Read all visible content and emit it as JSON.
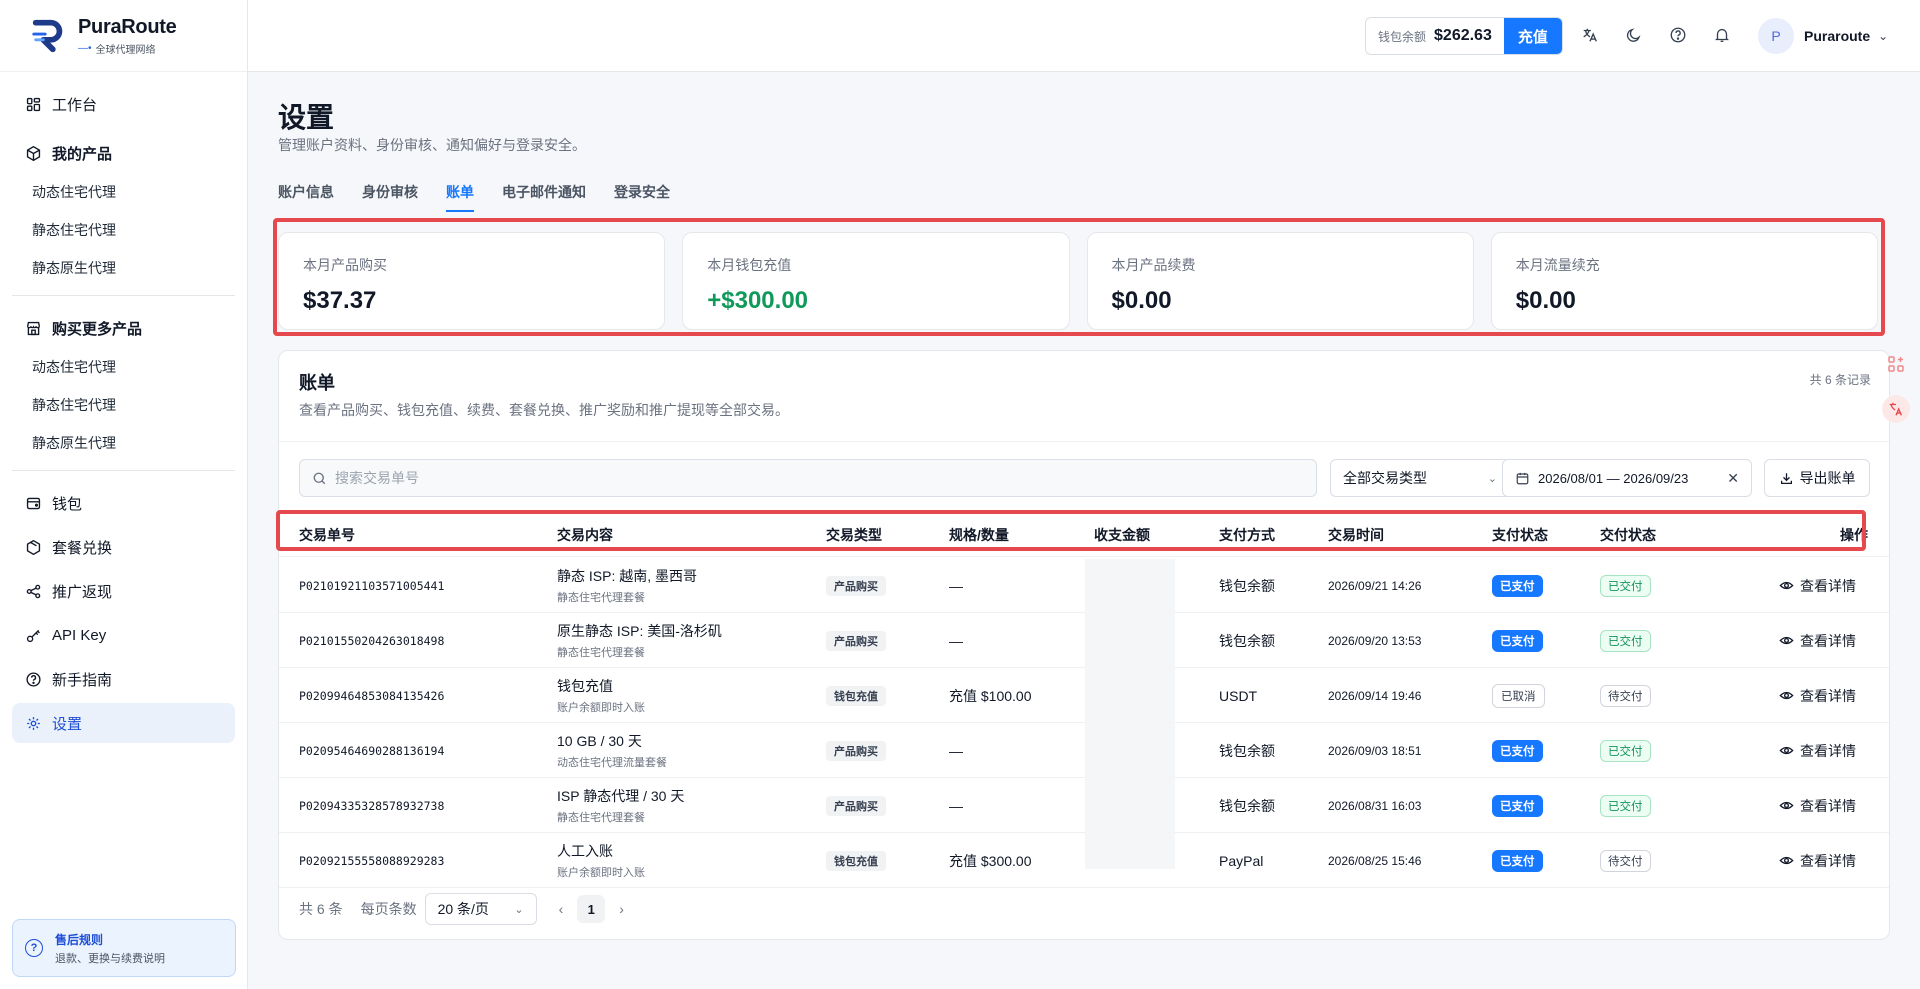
{
  "brand": {
    "name": "PuraRoute",
    "tagline": "全球代理网络"
  },
  "sidebar": {
    "workbench": "工作台",
    "my_products": {
      "label": "我的产品",
      "items": [
        "动态住宅代理",
        "静态住宅代理",
        "静态原生代理"
      ]
    },
    "buy_more": {
      "label": "购买更多产品",
      "items": [
        "动态住宅代理",
        "静态住宅代理",
        "静态原生代理"
      ]
    },
    "wallet": "钱包",
    "redeem": "套餐兑换",
    "referral": "推广返现",
    "api_key": "API Key",
    "guide": "新手指南",
    "settings": "设置",
    "after_sale": {
      "title": "售后规则",
      "desc": "退款、更换与续费说明"
    }
  },
  "topbar": {
    "wallet_label": "钱包余额",
    "wallet_amount": "$262.63",
    "recharge": "充值",
    "user_initial": "P",
    "user_name": "Puraroute"
  },
  "page": {
    "title": "设置",
    "subtitle": "管理账户资料、身份审核、通知偏好与登录安全。",
    "tabs": [
      "账户信息",
      "身份审核",
      "账单",
      "电子邮件通知",
      "登录安全"
    ],
    "active_tab": "账单"
  },
  "stats": [
    {
      "label": "本月产品购买",
      "value": "$37.37"
    },
    {
      "label": "本月钱包充值",
      "value": "+$300.00"
    },
    {
      "label": "本月产品续费",
      "value": "$0.00"
    },
    {
      "label": "本月流量续充",
      "value": "$0.00"
    }
  ],
  "billing": {
    "title": "账单",
    "subtitle": "查看产品购买、钱包充值、续费、套餐兑换、推广奖励和推广提现等全部交易。",
    "count": "共 6 条记录",
    "search_placeholder": "搜索交易单号",
    "type_filter": "全部交易类型",
    "date_range": "2026/08/01 — 2026/09/23",
    "export": "导出账单",
    "columns": [
      "交易单号",
      "交易内容",
      "交易类型",
      "规格/数量",
      "收支金额",
      "支付方式",
      "交易时间",
      "支付状态",
      "交付状态",
      "操作"
    ],
    "rows": [
      {
        "id": "P02101921103571005441",
        "content": "静态 ISP: 越南, 墨西哥",
        "content_sub": "静态住宅代理套餐",
        "type": "产品购买",
        "spec": "—",
        "method": "钱包余额",
        "time": "2026/09/21 14:26",
        "pay": "已支付",
        "deliv": "已交付",
        "action": "查看详情"
      },
      {
        "id": "P02101550204263018498",
        "content": "原生静态 ISP: 美国-洛杉矶",
        "content_sub": "静态住宅代理套餐",
        "type": "产品购买",
        "spec": "—",
        "method": "钱包余额",
        "time": "2026/09/20 13:53",
        "pay": "已支付",
        "deliv": "已交付",
        "action": "查看详情"
      },
      {
        "id": "P02099464853084135426",
        "content": "钱包充值",
        "content_sub": "账户余额即时入账",
        "type": "钱包充值",
        "spec": "充值 $100.00",
        "method": "USDT",
        "time": "2026/09/14 19:46",
        "pay": "已取消",
        "deliv": "待交付",
        "action": "查看详情"
      },
      {
        "id": "P02095464690288136194",
        "content": "10 GB / 30 天",
        "content_sub": "动态住宅代理流量套餐",
        "type": "产品购买",
        "spec": "—",
        "method": "钱包余额",
        "time": "2026/09/03 18:51",
        "pay": "已支付",
        "deliv": "已交付",
        "action": "查看详情"
      },
      {
        "id": "P02094335328578932738",
        "content": "ISP 静态代理 / 30 天",
        "content_sub": "静态住宅代理套餐",
        "type": "产品购买",
        "spec": "—",
        "method": "钱包余额",
        "time": "2026/08/31 16:03",
        "pay": "已支付",
        "deliv": "已交付",
        "action": "查看详情"
      },
      {
        "id": "P02092155558088929283",
        "content": "人工入账",
        "content_sub": "账户余额即时入账",
        "type": "钱包充值",
        "spec": "充值 $300.00",
        "method": "PayPal",
        "time": "2026/08/25 15:46",
        "pay": "已支付",
        "deliv": "待交付",
        "action": "查看详情"
      }
    ],
    "pager": {
      "total": "共 6 条",
      "per_page_label": "每页条数",
      "per_page": "20 条/页",
      "page": "1"
    }
  },
  "colors": {
    "primary": "#1677ff",
    "positive": "#0f9a5a",
    "highlight": "#e5484d"
  }
}
